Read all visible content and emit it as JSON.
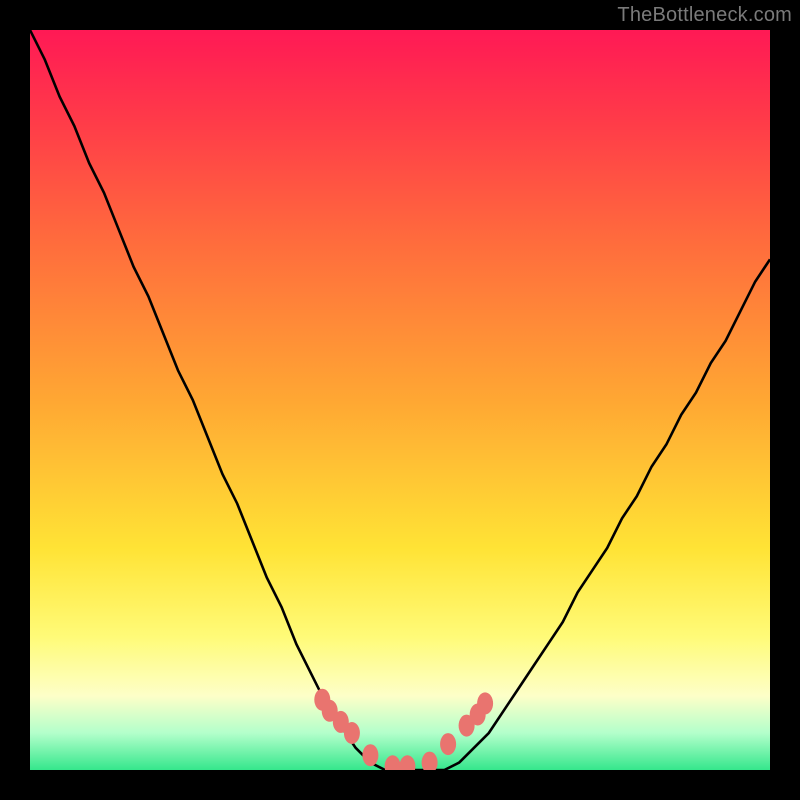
{
  "watermark": "TheBottleneck.com",
  "colors": {
    "background": "#000000",
    "curve_stroke": "#000000",
    "marker_fill": "#e9746f",
    "gradient_stops": [
      "#ff1955",
      "#ff3a49",
      "#ff6a3d",
      "#ffa733",
      "#ffe335",
      "#fffb78",
      "#fdffc8",
      "#b3ffcb",
      "#35e78c"
    ]
  },
  "chart_data": {
    "type": "line",
    "title": "",
    "xlabel": "",
    "ylabel": "",
    "xlim": [
      0,
      1
    ],
    "ylim": [
      0,
      1
    ],
    "x": [
      0.0,
      0.02,
      0.04,
      0.06,
      0.08,
      0.1,
      0.12,
      0.14,
      0.16,
      0.18,
      0.2,
      0.22,
      0.24,
      0.26,
      0.28,
      0.3,
      0.32,
      0.34,
      0.36,
      0.38,
      0.4,
      0.42,
      0.44,
      0.46,
      0.48,
      0.5,
      0.52,
      0.54,
      0.56,
      0.58,
      0.6,
      0.62,
      0.64,
      0.66,
      0.68,
      0.7,
      0.72,
      0.74,
      0.76,
      0.78,
      0.8,
      0.82,
      0.84,
      0.86,
      0.88,
      0.9,
      0.92,
      0.94,
      0.96,
      0.98,
      1.0
    ],
    "values": [
      1.0,
      0.96,
      0.91,
      0.87,
      0.82,
      0.78,
      0.73,
      0.68,
      0.64,
      0.59,
      0.54,
      0.5,
      0.45,
      0.4,
      0.36,
      0.31,
      0.26,
      0.22,
      0.17,
      0.13,
      0.09,
      0.06,
      0.03,
      0.01,
      0.0,
      0.0,
      0.0,
      0.0,
      0.0,
      0.01,
      0.03,
      0.05,
      0.08,
      0.11,
      0.14,
      0.17,
      0.2,
      0.24,
      0.27,
      0.3,
      0.34,
      0.37,
      0.41,
      0.44,
      0.48,
      0.51,
      0.55,
      0.58,
      0.62,
      0.66,
      0.69
    ],
    "markers": {
      "x": [
        0.395,
        0.405,
        0.42,
        0.435,
        0.46,
        0.49,
        0.51,
        0.54,
        0.565,
        0.59,
        0.605,
        0.615
      ],
      "y": [
        0.095,
        0.08,
        0.065,
        0.05,
        0.02,
        0.005,
        0.005,
        0.01,
        0.035,
        0.06,
        0.075,
        0.09
      ]
    }
  }
}
